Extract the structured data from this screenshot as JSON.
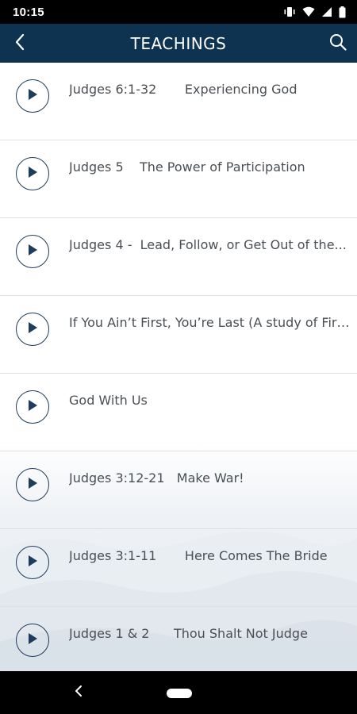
{
  "status_bar": {
    "time": "10:15"
  },
  "app_bar": {
    "title": "TEACHINGS"
  },
  "teachings": [
    {
      "title": "Judges 6:1-32       Experiencing God"
    },
    {
      "title": "Judges 5    The Power of Participation"
    },
    {
      "title": "Judges 4 -  Lead, Follow, or Get Out of the..."
    },
    {
      "title": "If You Ain’t First, You’re Last (A study of Firs..."
    },
    {
      "title": "God With Us"
    },
    {
      "title": "Judges 3:12-21   Make War!"
    },
    {
      "title": "Judges 3:1-11       Here Comes The Bride"
    },
    {
      "title": "Judges 1 & 2      Thou Shalt Not Judge"
    }
  ],
  "colors": {
    "app_bar": "#0d3350",
    "play_icon": "#1e3c5c",
    "text": "#4a4f55",
    "divider": "#dcdfe3"
  }
}
